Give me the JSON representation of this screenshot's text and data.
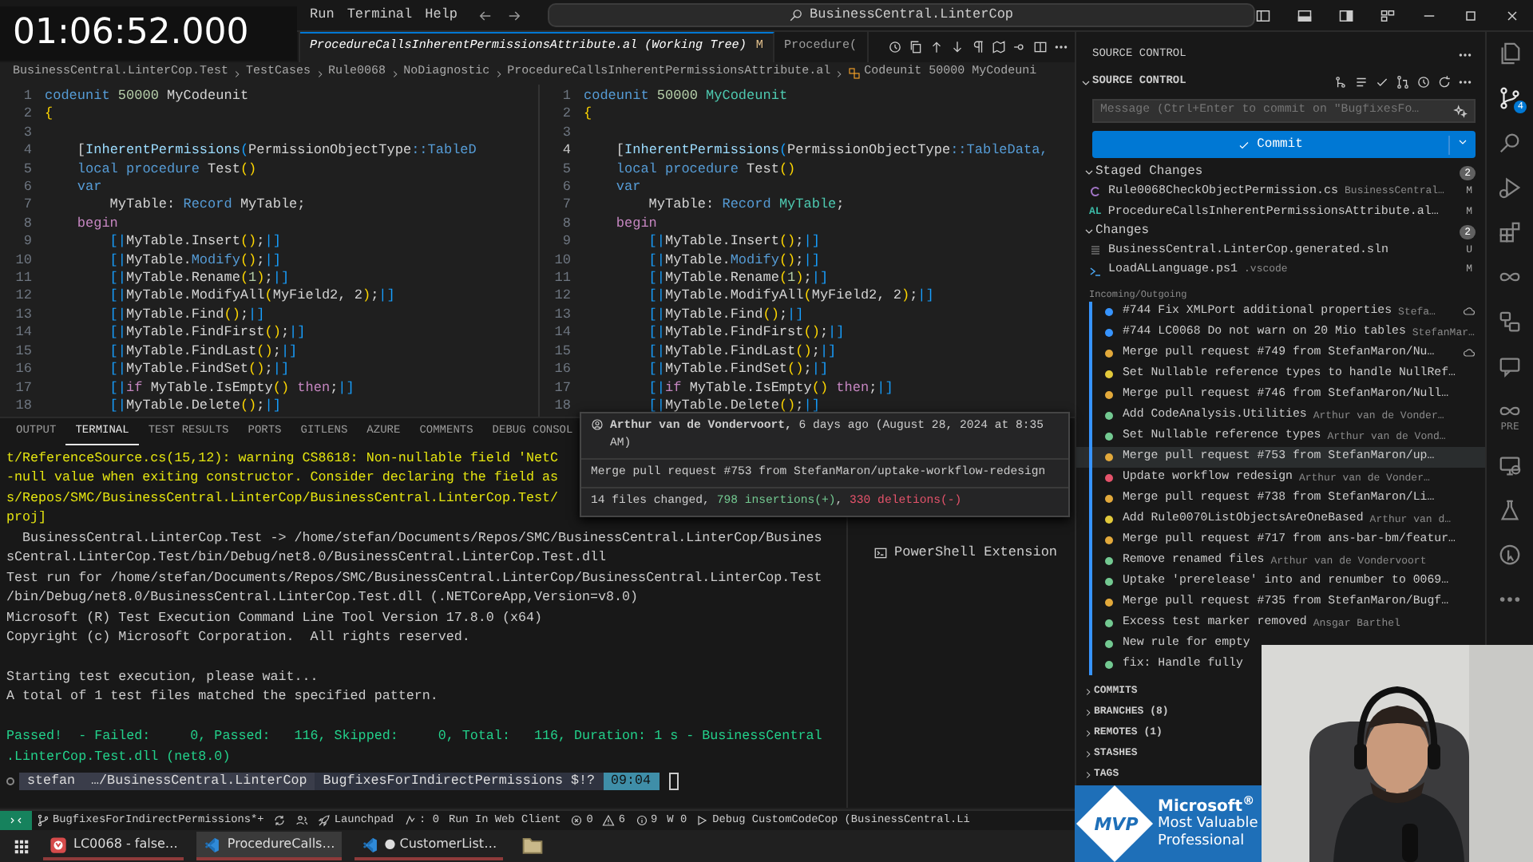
{
  "overlay_time": "01:06:52.000",
  "menu": [
    "Run",
    "Terminal",
    "Help"
  ],
  "command_center": "BusinessCentral.LinterCop",
  "editor": {
    "tabs": [
      {
        "label": "ProcedureCallsInherentPermissionsAttribute.al (Working Tree)",
        "badge": "M",
        "selected": true
      },
      {
        "label": "Procedure(",
        "selected": false
      }
    ],
    "breadcrumb": [
      "BusinessCentral.LinterCop.Test",
      "TestCases",
      "Rule0068",
      "NoDiagnostic",
      "ProcedureCallsInherentPermissionsAttribute.al",
      "Codeunit 50000 MyCodeuni"
    ],
    "panes": [
      {
        "lines": [
          {
            "n": "1",
            "current": false,
            "code": [
              {
                "text": "codeunit",
                "kind": "keyword"
              },
              {
                "text": " 50000 ",
                "kind": "number"
              },
              {
                "text": "MyCodeunit",
                "kind": "plain"
              }
            ]
          },
          {
            "n": "2",
            "current": false,
            "code": [
              {
                "text": "{",
                "kind": "bracket"
              }
            ]
          },
          {
            "n": "3",
            "current": false
          },
          {
            "n": "4",
            "current": false,
            "code": [
              {
                "text": "    [",
                "kind": "plain"
              },
              {
                "text": "InherentPermissions",
                "kind": "variable"
              },
              {
                "text": "(",
                "kind": "marker"
              },
              {
                "text": "PermissionObjectType",
                "kind": "plain"
              },
              {
                "text": "::TableD",
                "kind": "keyword"
              }
            ]
          },
          {
            "n": "5",
            "current": false,
            "code": [
              {
                "text": "    local procedure ",
                "kind": "keyword"
              },
              {
                "text": "Test",
                "kind": "plain"
              },
              {
                "text": "()",
                "kind": "bracket"
              }
            ]
          },
          {
            "n": "6",
            "current": false,
            "code": [
              {
                "text": "    var",
                "kind": "keyword"
              }
            ]
          },
          {
            "n": "7",
            "current": false,
            "code": [
              {
                "text": "        MyTable: ",
                "kind": "plain"
              },
              {
                "text": "Record ",
                "kind": "keyword"
              },
              {
                "text": "MyTable;",
                "kind": "plain"
              }
            ]
          },
          {
            "n": "8",
            "current": false,
            "code": [
              {
                "text": "    begin",
                "kind": "control"
              }
            ]
          },
          {
            "n": "9",
            "current": false,
            "code": [
              {
                "text": "        [|",
                "kind": "marker"
              },
              {
                "text": "MyTable.Insert",
                "kind": "plain"
              },
              {
                "text": "()",
                "kind": "bracket"
              },
              {
                "text": ";",
                "kind": "plain"
              },
              {
                "text": "|]",
                "kind": "marker"
              }
            ]
          },
          {
            "n": "10",
            "current": false,
            "code": [
              {
                "text": "        [|",
                "kind": "marker"
              },
              {
                "text": "MyTable.",
                "kind": "plain"
              },
              {
                "text": "Modify",
                "kind": "keyword"
              },
              {
                "text": "()",
                "kind": "bracket"
              },
              {
                "text": ";",
                "kind": "plain"
              },
              {
                "text": "|]",
                "kind": "marker"
              }
            ]
          },
          {
            "n": "11",
            "current": false,
            "code": [
              {
                "text": "        [|",
                "kind": "marker"
              },
              {
                "text": "MyTable.Rename",
                "kind": "plain"
              },
              {
                "text": "(",
                "kind": "bracket"
              },
              {
                "text": "1",
                "kind": "number"
              },
              {
                "text": ")",
                "kind": "bracket"
              },
              {
                "text": ";",
                "kind": "plain"
              },
              {
                "text": "|]",
                "kind": "marker"
              }
            ]
          },
          {
            "n": "12",
            "current": false,
            "code": [
              {
                "text": "        [|",
                "kind": "marker"
              },
              {
                "text": "MyTable.ModifyAll",
                "kind": "plain"
              },
              {
                "text": "(",
                "kind": "bracket"
              },
              {
                "text": "MyField2, 2",
                "kind": "plain"
              },
              {
                "text": ")",
                "kind": "bracket"
              },
              {
                "text": ";",
                "kind": "plain"
              },
              {
                "text": "|]",
                "kind": "marker"
              }
            ]
          },
          {
            "n": "13",
            "current": false,
            "code": [
              {
                "text": "        [|",
                "kind": "marker"
              },
              {
                "text": "MyTable.Find",
                "kind": "plain"
              },
              {
                "text": "()",
                "kind": "bracket"
              },
              {
                "text": ";",
                "kind": "plain"
              },
              {
                "text": "|]",
                "kind": "marker"
              }
            ]
          },
          {
            "n": "14",
            "current": false,
            "code": [
              {
                "text": "        [|",
                "kind": "marker"
              },
              {
                "text": "MyTable.FindFirst",
                "kind": "plain"
              },
              {
                "text": "()",
                "kind": "bracket"
              },
              {
                "text": ";",
                "kind": "plain"
              },
              {
                "text": "|]",
                "kind": "marker"
              }
            ]
          },
          {
            "n": "15",
            "current": false,
            "code": [
              {
                "text": "        [|",
                "kind": "marker"
              },
              {
                "text": "MyTable.FindLast",
                "kind": "plain"
              },
              {
                "text": "()",
                "kind": "bracket"
              },
              {
                "text": ";",
                "kind": "plain"
              },
              {
                "text": "|]",
                "kind": "marker"
              }
            ]
          },
          {
            "n": "16",
            "current": false,
            "code": [
              {
                "text": "        [|",
                "kind": "marker"
              },
              {
                "text": "MyTable.FindSet",
                "kind": "plain"
              },
              {
                "text": "()",
                "kind": "bracket"
              },
              {
                "text": ";",
                "kind": "plain"
              },
              {
                "text": "|]",
                "kind": "marker"
              }
            ]
          },
          {
            "n": "17",
            "current": false,
            "code": [
              {
                "text": "        [|",
                "kind": "marker"
              },
              {
                "text": "if ",
                "kind": "control"
              },
              {
                "text": "MyTable.IsEmpty",
                "kind": "plain"
              },
              {
                "text": "()",
                "kind": "bracket"
              },
              {
                "text": " then",
                "kind": "control"
              },
              {
                "text": ";",
                "kind": "plain"
              },
              {
                "text": "|]",
                "kind": "marker"
              }
            ]
          },
          {
            "n": "18",
            "current": false,
            "code": [
              {
                "text": "        [|",
                "kind": "marker"
              },
              {
                "text": "MyTable.Delete",
                "kind": "plain"
              },
              {
                "text": "()",
                "kind": "bracket"
              },
              {
                "text": ";",
                "kind": "plain"
              },
              {
                "text": "|]",
                "kind": "marker"
              }
            ]
          }
        ]
      },
      {
        "lines": [
          {
            "n": "1",
            "current": false,
            "code": [
              {
                "text": "codeunit",
                "kind": "keyword"
              },
              {
                "text": " 50000 ",
                "kind": "number"
              },
              {
                "text": "MyCodeunit",
                "kind": "type"
              }
            ]
          },
          {
            "n": "2",
            "current": false,
            "code": [
              {
                "text": "{",
                "kind": "bracket"
              }
            ]
          },
          {
            "n": "3",
            "current": false
          },
          {
            "n": "4",
            "current": true,
            "code": [
              {
                "text": "    [",
                "kind": "plain"
              },
              {
                "text": "InherentPermissions",
                "kind": "variable"
              },
              {
                "text": "(",
                "kind": "marker"
              },
              {
                "text": "PermissionObjectType",
                "kind": "plain"
              },
              {
                "text": "::TableData,",
                "kind": "keyword"
              }
            ]
          },
          {
            "n": "5",
            "current": false,
            "code": [
              {
                "text": "    local procedure ",
                "kind": "keyword"
              },
              {
                "text": "Test",
                "kind": "plain"
              },
              {
                "text": "()",
                "kind": "bracket"
              }
            ]
          },
          {
            "n": "6",
            "current": false,
            "code": [
              {
                "text": "    var",
                "kind": "keyword"
              }
            ]
          },
          {
            "n": "7",
            "current": false,
            "code": [
              {
                "text": "        MyTable: ",
                "kind": "plain"
              },
              {
                "text": "Record ",
                "kind": "keyword"
              },
              {
                "text": "MyTable",
                "kind": "type"
              },
              {
                "text": ";",
                "kind": "plain"
              }
            ]
          },
          {
            "n": "8",
            "current": false,
            "code": [
              {
                "text": "    begin",
                "kind": "control"
              }
            ]
          },
          {
            "n": "9",
            "current": false,
            "code": [
              {
                "text": "        [|",
                "kind": "marker"
              },
              {
                "text": "MyTable.Insert",
                "kind": "plain"
              },
              {
                "text": "()",
                "kind": "bracket"
              },
              {
                "text": ";",
                "kind": "plain"
              },
              {
                "text": "|]",
                "kind": "marker"
              }
            ]
          },
          {
            "n": "10",
            "current": false,
            "code": [
              {
                "text": "        [|",
                "kind": "marker"
              },
              {
                "text": "MyTable.",
                "kind": "plain"
              },
              {
                "text": "Modify",
                "kind": "keyword"
              },
              {
                "text": "()",
                "kind": "bracket"
              },
              {
                "text": ";",
                "kind": "plain"
              },
              {
                "text": "|]",
                "kind": "marker"
              }
            ]
          },
          {
            "n": "11",
            "current": false,
            "code": [
              {
                "text": "        [|",
                "kind": "marker"
              },
              {
                "text": "MyTable.Rename",
                "kind": "plain"
              },
              {
                "text": "(",
                "kind": "bracket"
              },
              {
                "text": "1",
                "kind": "number"
              },
              {
                "text": ")",
                "kind": "bracket"
              },
              {
                "text": ";",
                "kind": "plain"
              },
              {
                "text": "|]",
                "kind": "marker"
              }
            ]
          },
          {
            "n": "12",
            "current": false,
            "code": [
              {
                "text": "        [|",
                "kind": "marker"
              },
              {
                "text": "MyTable.ModifyAll",
                "kind": "plain"
              },
              {
                "text": "(",
                "kind": "bracket"
              },
              {
                "text": "MyField2, 2",
                "kind": "plain"
              },
              {
                "text": ")",
                "kind": "bracket"
              },
              {
                "text": ";",
                "kind": "plain"
              },
              {
                "text": "|]",
                "kind": "marker"
              }
            ]
          },
          {
            "n": "13",
            "current": false,
            "code": [
              {
                "text": "        [|",
                "kind": "marker"
              },
              {
                "text": "MyTable.Find",
                "kind": "plain"
              },
              {
                "text": "()",
                "kind": "bracket"
              },
              {
                "text": ";",
                "kind": "plain"
              },
              {
                "text": "|]",
                "kind": "marker"
              }
            ]
          },
          {
            "n": "14",
            "current": false,
            "code": [
              {
                "text": "        [|",
                "kind": "marker"
              },
              {
                "text": "MyTable.FindFirst",
                "kind": "plain"
              },
              {
                "text": "()",
                "kind": "bracket"
              },
              {
                "text": ";",
                "kind": "plain"
              },
              {
                "text": "|]",
                "kind": "marker"
              }
            ]
          },
          {
            "n": "15",
            "current": false,
            "code": [
              {
                "text": "        [|",
                "kind": "marker"
              },
              {
                "text": "MyTable.FindLast",
                "kind": "plain"
              },
              {
                "text": "()",
                "kind": "bracket"
              },
              {
                "text": ";",
                "kind": "plain"
              },
              {
                "text": "|]",
                "kind": "marker"
              }
            ]
          },
          {
            "n": "16",
            "current": false,
            "code": [
              {
                "text": "        [|",
                "kind": "marker"
              },
              {
                "text": "MyTable.FindSet",
                "kind": "plain"
              },
              {
                "text": "()",
                "kind": "bracket"
              },
              {
                "text": ";",
                "kind": "plain"
              },
              {
                "text": "|]",
                "kind": "marker"
              }
            ]
          },
          {
            "n": "17",
            "current": false,
            "code": [
              {
                "text": "        [|",
                "kind": "marker"
              },
              {
                "text": "if ",
                "kind": "control"
              },
              {
                "text": "MyTable.IsEmpty",
                "kind": "plain"
              },
              {
                "text": "()",
                "kind": "bracket"
              },
              {
                "text": " then",
                "kind": "control"
              },
              {
                "text": ";",
                "kind": "plain"
              },
              {
                "text": "|]",
                "kind": "marker"
              }
            ]
          },
          {
            "n": "18",
            "current": false,
            "code": [
              {
                "text": "        [|",
                "kind": "marker"
              },
              {
                "text": "MyTable.Delete",
                "kind": "plain"
              },
              {
                "text": "()",
                "kind": "bracket"
              },
              {
                "text": ";",
                "kind": "plain"
              },
              {
                "text": "|]",
                "kind": "marker"
              }
            ]
          }
        ]
      }
    ]
  },
  "panel": {
    "tabs": [
      {
        "label": "OUTPUT",
        "selected": false
      },
      {
        "label": "TERMINAL",
        "selected": true
      },
      {
        "label": "TEST RESULTS",
        "selected": false
      },
      {
        "label": "PORTS",
        "selected": false
      },
      {
        "label": "GITLENS",
        "selected": false
      },
      {
        "label": "AZURE",
        "selected": false
      },
      {
        "label": "COMMENTS",
        "selected": false
      },
      {
        "label": "DEBUG CONSOL",
        "selected": false
      }
    ],
    "terminal": [
      {
        "kind": "warning",
        "text": "t/ReferenceSource.cs(15,12): warning CS8618: Non-nullable field 'NetC"
      },
      {
        "kind": "warning",
        "text": "-null value when exiting constructor. Consider declaring the field as"
      },
      {
        "kind": "warning",
        "text": "s/Repos/SMC/BusinessCentral.LinterCop/BusinessCentral.LinterCop.Test/"
      },
      {
        "kind": "warning",
        "text": "proj]"
      },
      {
        "kind": "plain",
        "text": "  BusinessCentral.LinterCop.Test -> /home/stefan/Documents/Repos/SMC/BusinessCentral.LinterCop/Busines"
      },
      {
        "kind": "plain",
        "text": "sCentral.LinterCop.Test/bin/Debug/net8.0/BusinessCentral.LinterCop.Test.dll"
      },
      {
        "kind": "plain",
        "text": "Test run for /home/stefan/Documents/Repos/SMC/BusinessCentral.LinterCop/BusinessCentral.LinterCop.Test"
      },
      {
        "kind": "plain",
        "text": "/bin/Debug/net8.0/BusinessCentral.LinterCop.Test.dll (.NETCoreApp,Version=v8.0)"
      },
      {
        "kind": "plain",
        "text": "Microsoft (R) Test Execution Command Line Tool Version 17.8.0 (x64)"
      },
      {
        "kind": "plain",
        "text": "Copyright (c) Microsoft Corporation.  All rights reserved."
      },
      {
        "kind": "spacer"
      },
      {
        "kind": "plain",
        "text": "Starting test execution, please wait..."
      },
      {
        "kind": "plain",
        "text": "A total of 1 test files matched the specified pattern."
      },
      {
        "kind": "spacer"
      },
      {
        "kind": "success",
        "text": "Passed!  - Failed:     0, Passed:   116, Skipped:     0, Total:   116, Duration: 1 s - BusinessCentral"
      },
      {
        "kind": "success",
        "text": ".LinterCop.Test.dll (net8.0)"
      }
    ],
    "prompt": [
      {
        "kind": "user",
        "text": "stefan"
      },
      {
        "kind": "path",
        "text": "…/BusinessCentral.LinterCop"
      },
      {
        "kind": "git",
        "text": "BugfixesForIndirectPermissions $!?"
      },
      {
        "kind": "time",
        "text": "09:04"
      }
    ],
    "terminals": [
      "PowerShell Extension"
    ]
  },
  "tooltip": {
    "header": "**Arthur van de Vondervoort,** 6 days ago (August 28, 2024 at 8:35 AM)",
    "message": "Merge pull request #753 from StefanMaron/uptake-workflow-redesign",
    "stats": [
      {
        "kind": "plain",
        "text": "14 files changed, "
      },
      {
        "kind": "added",
        "text": "798 insertions(+)"
      },
      {
        "kind": "plain",
        "text": ", "
      },
      {
        "kind": "removed",
        "text": "330 deletions(-)"
      }
    ]
  },
  "source_control": {
    "title": "SOURCE CONTROL",
    "section": "SOURCE CONTROL",
    "message_placeholder": "Message (Ctrl+Enter to commit on \"BugfixesFo…",
    "commit_label": "Commit",
    "groups": [
      {
        "label": "Staged Changes",
        "count": "2",
        "expanded": true,
        "files": [
          {
            "kind": "csharp",
            "name": "Rule0068CheckObjectPermission.cs",
            "detail": "BusinessCentral…",
            "status": "M"
          },
          {
            "kind": "al",
            "icon_text": "AL",
            "name": "ProcedureCallsInherentPermissionsAttribute.al…",
            "status": "M"
          }
        ]
      },
      {
        "label": "Changes",
        "count": "2",
        "expanded": true,
        "files": [
          {
            "kind": "sln",
            "name": "BusinessCentral.LinterCop.generated.sln",
            "status": "U"
          },
          {
            "kind": "ps1",
            "name": "LoadALLanguage.ps1",
            "detail": ".vscode",
            "status": "M"
          }
        ]
      }
    ],
    "graph_title": "Incoming/Outgoing",
    "commits": [
      {
        "message": "#744 Fix XMLPort additional properties",
        "author": "Stefa…",
        "color": "#3794ff",
        "cloud": true,
        "hovered": false
      },
      {
        "message": "#744 LC0068 Do not warn on 20 Mio tables",
        "author": "StefanMar…",
        "color": "#3794ff",
        "cloud": false,
        "hovered": false
      },
      {
        "message": "Merge pull request #749 from StefanMaron/Nu…",
        "color": "#e2a93b",
        "cloud": true,
        "hovered": false
      },
      {
        "message": "Set Nullable reference types to handle NullRef…",
        "color": "#e2c93b",
        "cloud": false,
        "hovered": false
      },
      {
        "message": "Merge pull request #746 from StefanMaron/Null…",
        "color": "#e2a93b",
        "cloud": false,
        "hovered": false
      },
      {
        "message": "Add CodeAnalysis.Utilities",
        "author": "Arthur van de Vonder…",
        "color": "#73c991",
        "cloud": false,
        "hovered": false
      },
      {
        "message": "Set Nullable reference types",
        "author": "Arthur van de Vond…",
        "color": "#73c991",
        "cloud": false,
        "hovered": false
      },
      {
        "message": "Merge pull request #753 from StefanMaron/up…",
        "color": "#e2a93b",
        "cloud": false,
        "hovered": true
      },
      {
        "message": "Update workflow redesign",
        "author": "Arthur van de Vonder…",
        "color": "#e5536b",
        "cloud": false,
        "hovered": false
      },
      {
        "message": "Merge pull request #738 from StefanMaron/Li…",
        "color": "#e2a93b",
        "cloud": false,
        "hovered": false
      },
      {
        "message": "Add Rule0070ListObjectsAreOneBased",
        "author": "Arthur van d…",
        "color": "#e2c93b",
        "cloud": false,
        "hovered": false
      },
      {
        "message": "Merge pull request #717 from ans-bar-bm/featur…",
        "color": "#e2a93b",
        "cloud": false,
        "hovered": false
      },
      {
        "message": "Remove renamed files",
        "author": "Arthur van de Vondervoort",
        "color": "#73c991",
        "cloud": false,
        "hovered": false
      },
      {
        "message": "Uptake 'prerelease' into and renumber to 0069…",
        "color": "#73c991",
        "cloud": false,
        "hovered": false
      },
      {
        "message": "Merge pull request #735 from StefanMaron/Bugf…",
        "color": "#e2a93b",
        "cloud": false,
        "hovered": false
      },
      {
        "message": "Excess test marker removed",
        "author": "Ansgar Barthel",
        "color": "#73c991",
        "cloud": false,
        "hovered": false
      },
      {
        "message": "New rule for empty",
        "color": "#73c991",
        "cloud": false,
        "hovered": false
      },
      {
        "message": "fix: Handle fully",
        "color": "#73c991",
        "cloud": false,
        "hovered": false
      }
    ],
    "sections": [
      {
        "label": "COMMITS",
        "expanded": false
      },
      {
        "label": "BRANCHES (8)",
        "expanded": false
      },
      {
        "label": "REMOTES (1)",
        "expanded": false
      },
      {
        "label": "STASHES",
        "expanded": false
      },
      {
        "label": "TAGS",
        "expanded": false
      }
    ]
  },
  "activity_bar": [
    {
      "kind": "files",
      "selected": false
    },
    {
      "kind": "scm",
      "selected": true,
      "badge": "4"
    },
    {
      "kind": "search",
      "selected": false
    },
    {
      "kind": "debug",
      "selected": false
    },
    {
      "kind": "extensions",
      "selected": false
    },
    {
      "kind": "infinity",
      "selected": false
    },
    {
      "kind": "remote",
      "selected": false
    },
    {
      "kind": "chat",
      "selected": false
    },
    {
      "kind": "infinity",
      "selected": false,
      "label": "PRE"
    },
    {
      "kind": "monitor",
      "selected": false
    },
    {
      "kind": "flask",
      "selected": false
    },
    {
      "kind": "pointer",
      "selected": false
    },
    {
      "kind": "more",
      "selected": false
    }
  ],
  "status_bar": [
    {
      "kind": "remote"
    },
    {
      "kind": "branch",
      "text": "BugfixesForIndirectPermissions*+"
    },
    {
      "kind": "sync"
    },
    {
      "kind": "publish"
    },
    {
      "kind": "launchpad",
      "text": "Launchpad"
    },
    {
      "kind": "ports",
      "text": ": 0"
    },
    {
      "kind": "plain",
      "text": "Run In Web Client"
    },
    {
      "kind": "errors",
      "text": "0"
    },
    {
      "kind": "warnings",
      "text": "6"
    },
    {
      "kind": "info",
      "text": "9"
    },
    {
      "kind": "plain",
      "text": "W 0"
    },
    {
      "kind": "debug",
      "text": "Debug CustomCodeCop (BusinessCentral.Li"
    }
  ],
  "taskbar": [
    {
      "kind": "browser",
      "label": "LC0068 - false…",
      "selected": false
    },
    {
      "kind": "vscode",
      "label": "ProcedureCalls…",
      "selected": true
    },
    {
      "kind": "vscode",
      "label": "● CustomerList…",
      "selected": false
    },
    {
      "kind": "folder",
      "selected": false
    }
  ],
  "mvp": {
    "mark": "MVP",
    "lines": [
      "Microsoft$^{®}$",
      "Most Valuable",
      "Professional"
    ]
  },
  "webcam": {
    "kind": "picture"
  }
}
